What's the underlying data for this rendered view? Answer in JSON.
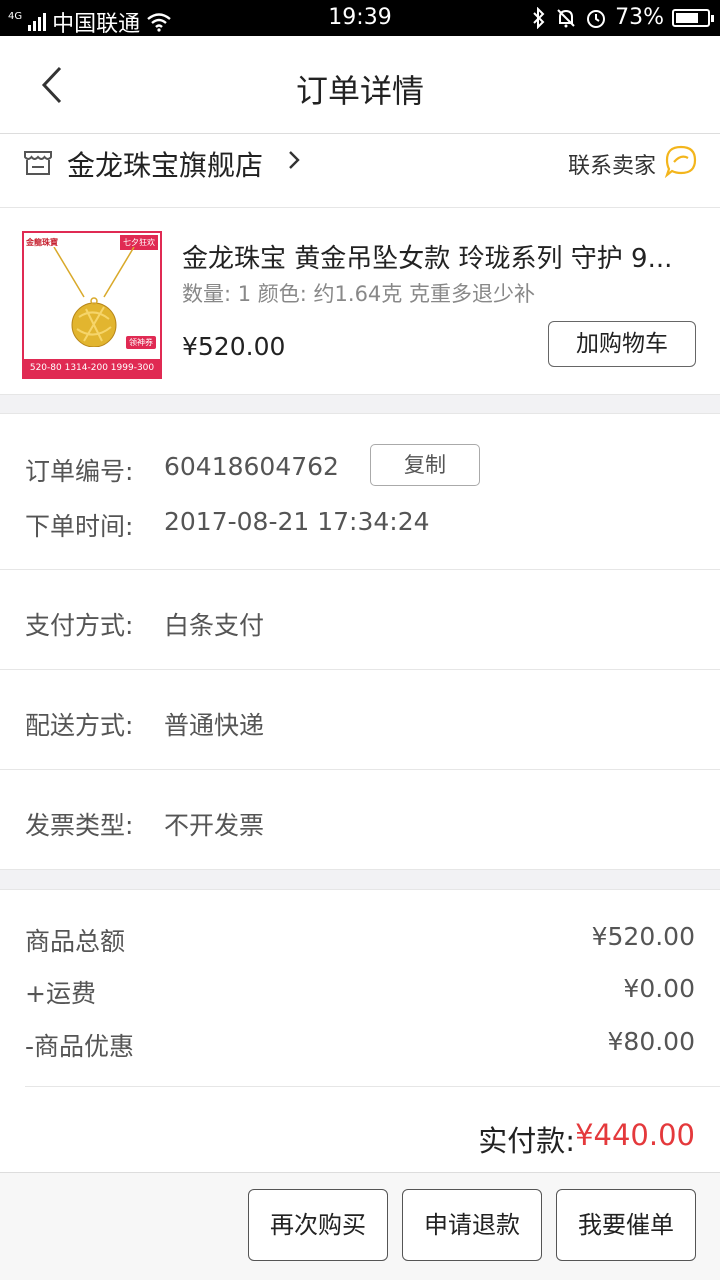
{
  "status_bar": {
    "network": "4G",
    "carrier": "中国联通",
    "time": "19:39",
    "battery": "73%",
    "battery_level": 0.73,
    "icons": [
      "signal-icon",
      "wifi-icon",
      "bluetooth-icon",
      "mute-bell-icon",
      "alarm-icon",
      "battery-icon"
    ]
  },
  "header": {
    "title": "订单详情",
    "back_icon": "chevron-left-icon"
  },
  "store": {
    "name": "金龙珠宝旗舰店",
    "contact_label": "联系卖家",
    "store_icon": "shop-icon",
    "chat_icon": "chat-bubble-icon"
  },
  "product": {
    "title": "金龙珠宝 黄金吊坠女款 玲珑系列 守护 9...",
    "spec": "数量: 1 颜色: 约1.64克 克重多退少补",
    "price": "¥520.00",
    "add_cart_label": "加购物车",
    "thumbnail": {
      "brand": "金龍珠寶",
      "promo": "七夕狂欢",
      "coupon": "领神券",
      "strip": "520-80 1314-200 1999-300"
    }
  },
  "order": {
    "number_label": "订单编号:",
    "number_value": "60418604762",
    "copy_label": "复制",
    "time_label": "下单时间:",
    "time_value": "2017-08-21 17:34:24"
  },
  "payment": {
    "label": "支付方式:",
    "value": "白条支付"
  },
  "delivery": {
    "label": "配送方式:",
    "value": "普通快递"
  },
  "invoice": {
    "label": "发票类型:",
    "value": "不开发票"
  },
  "summary": {
    "items": [
      {
        "label": "商品总额",
        "value": "¥520.00"
      },
      {
        "label": "+运费",
        "value": "¥0.00"
      },
      {
        "label": "-商品优惠",
        "value": "¥80.00"
      }
    ],
    "total_label": "实付款:",
    "total_value": "¥440.00",
    "total_color": "#e4393c"
  },
  "actions": {
    "buy_again": "再次购买",
    "refund": "申请退款",
    "urge": "我要催单"
  }
}
